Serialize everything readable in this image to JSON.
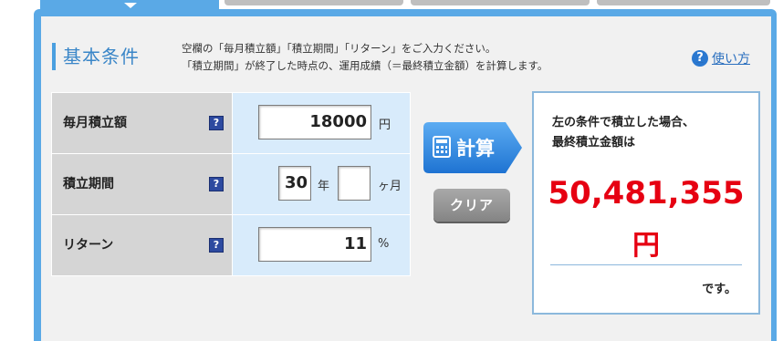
{
  "header": {
    "title": "基本条件",
    "desc_line1": "空欄の「毎月積立額」「積立期間」「リターン」をご入力ください。",
    "desc_line2": "「積立期間」が終了した時点の、運用成績（＝最終積立金額）を計算します。",
    "help_icon": "?",
    "help_label": "使い方"
  },
  "form": {
    "rows": [
      {
        "label": "毎月積立額",
        "q": "?",
        "value": "18000",
        "unit": "円"
      },
      {
        "label": "積立期間",
        "q": "?",
        "value": "30",
        "unit": "年",
        "value2": "",
        "unit2": "ヶ月"
      },
      {
        "label": "リターン",
        "q": "?",
        "value": "11",
        "unit": "%"
      }
    ]
  },
  "buttons": {
    "calc_label": "計算",
    "clear_label": "クリア"
  },
  "result": {
    "intro_line1": "左の条件で積立した場合、",
    "intro_line2": "最終積立金額は",
    "amount": "50,481,355",
    "currency": "円",
    "suffix": "です。"
  },
  "colors": {
    "accent": "#5aa9e6",
    "result_red": "#e60012",
    "calc_button": "#2f86e0"
  }
}
